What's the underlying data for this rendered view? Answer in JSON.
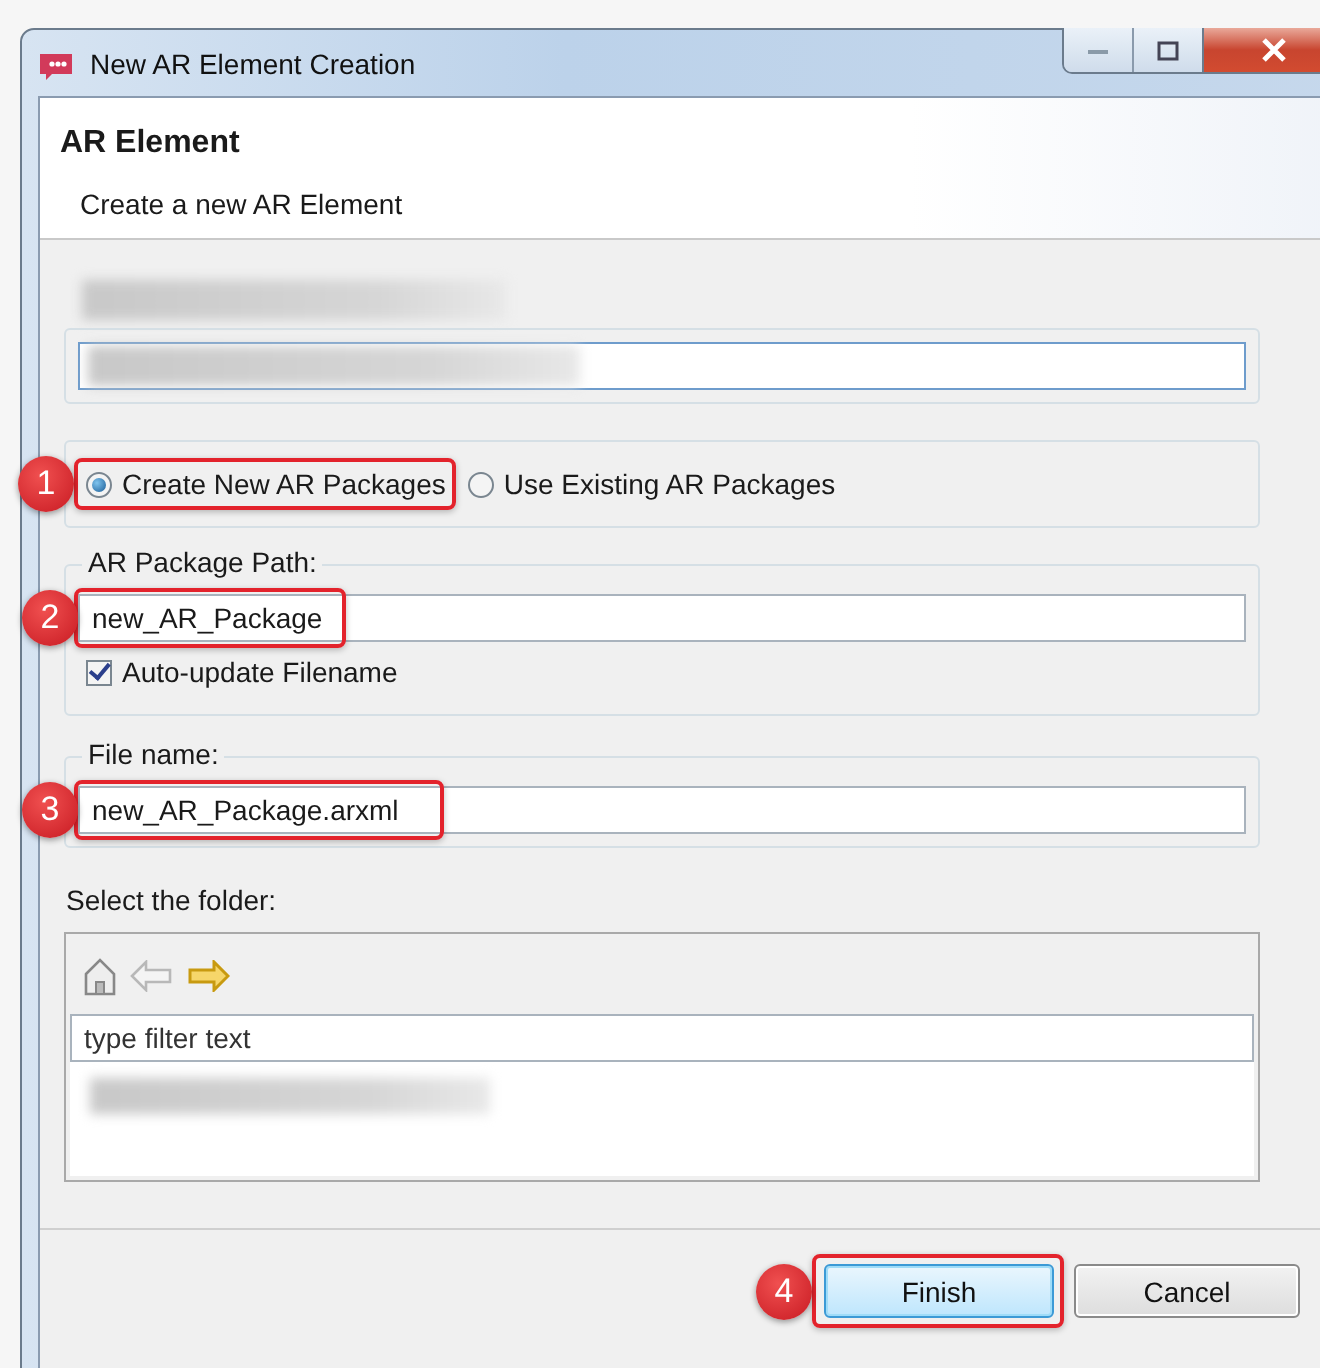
{
  "window": {
    "title": "New AR Element Creation"
  },
  "header": {
    "title": "AR Element",
    "description": "Create a new AR Element"
  },
  "package_mode": {
    "callout": "1",
    "options": [
      {
        "label": "Create New AR Packages",
        "selected": true
      },
      {
        "label": "Use Existing AR Packages",
        "selected": false
      }
    ]
  },
  "package_path": {
    "label": "AR Package Path:",
    "value": "new_AR_Package",
    "callout": "2"
  },
  "auto_update": {
    "label": "Auto-update Filename",
    "checked": true
  },
  "file_name": {
    "label": "File name:",
    "value": "new_AR_Package.arxml",
    "callout": "3"
  },
  "folder": {
    "label": "Select the folder:",
    "filter_placeholder": "type filter text"
  },
  "buttons": [
    {
      "label": "Finish",
      "kind": "default",
      "callout": "4"
    },
    {
      "label": "Cancel",
      "kind": "normal"
    }
  ]
}
